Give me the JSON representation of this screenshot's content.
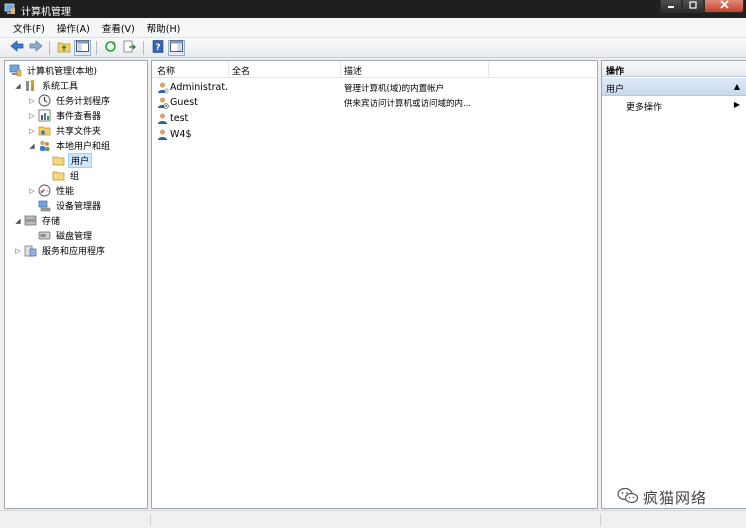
{
  "window": {
    "title": "计算机管理"
  },
  "menu": {
    "items": [
      "文件(F)",
      "操作(A)",
      "查看(V)",
      "帮助(H)"
    ]
  },
  "toolbar": {
    "buttons": [
      "back-icon",
      "forward-icon",
      "up-folder-icon",
      "show-hide-console-tree-icon",
      "refresh-icon",
      "export-list-icon",
      "help-icon",
      "show-hide-action-pane-icon"
    ]
  },
  "tree": {
    "root": "计算机管理(本地)",
    "system_tools": "系统工具",
    "task_scheduler": "任务计划程序",
    "event_viewer": "事件查看器",
    "shared_folders": "共享文件夹",
    "local_users_groups": "本地用户和组",
    "users": "用户",
    "groups": "组",
    "performance": "性能",
    "device_manager": "设备管理器",
    "storage": "存储",
    "disk_management": "磁盘管理",
    "services_apps": "服务和应用程序"
  },
  "list": {
    "columns": [
      "名称",
      "全名",
      "描述"
    ],
    "rows": [
      {
        "name": "Administrat...",
        "fullname": "",
        "description": "管理计算机(域)的内置帐户"
      },
      {
        "name": "Guest",
        "fullname": "",
        "description": "供来宾访问计算机或访问域的内..."
      },
      {
        "name": "test",
        "fullname": "",
        "description": ""
      },
      {
        "name": "W4$",
        "fullname": "",
        "description": ""
      }
    ]
  },
  "actions": {
    "title": "操作",
    "section": "用户",
    "more": "更多操作"
  },
  "watermark": {
    "text": "疯猫网络"
  },
  "colors": {
    "titlebar": "#1e1f1f",
    "selection": "#cce8ff",
    "action_section": "#c8d9ee",
    "close_button": "#c3412b"
  }
}
